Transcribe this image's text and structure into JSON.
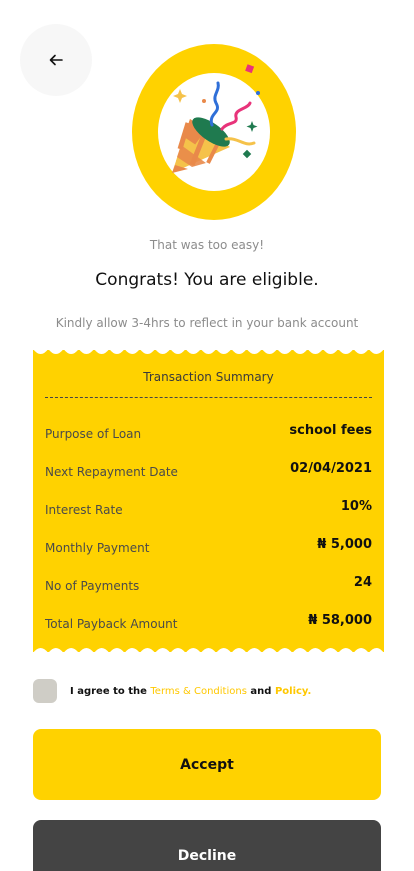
{
  "header": {
    "back_icon": "arrow-left-icon"
  },
  "hero": {
    "icon": "party-popper-icon",
    "ring_color": "#ffd200"
  },
  "subtitle": "That was too easy!",
  "title": "Congrats! You are eligible.",
  "note": "Kindly allow 3-4hrs to reflect in your bank account",
  "summary": {
    "header": "Transaction Summary",
    "rows": [
      {
        "label": "Purpose of Loan",
        "value": "school fees"
      },
      {
        "label": "Next Repayment Date",
        "value": "02/04/2021"
      },
      {
        "label": "Interest Rate",
        "value": "10%"
      },
      {
        "label": "Monthly Payment",
        "value": "₦ 5,000"
      },
      {
        "label": "No of Payments",
        "value": "24"
      },
      {
        "label": "Total Payback Amount",
        "value": "₦ 58,000"
      }
    ]
  },
  "agreement": {
    "prefix": "I agree to the",
    "terms_link": "Terms & Conditions",
    "and": "and",
    "policy_link": "Policy."
  },
  "buttons": {
    "accept": "Accept",
    "decline": "Decline"
  },
  "colors": {
    "accent": "#ffd200",
    "decline_bg": "#444444",
    "link": "#ffc800"
  }
}
